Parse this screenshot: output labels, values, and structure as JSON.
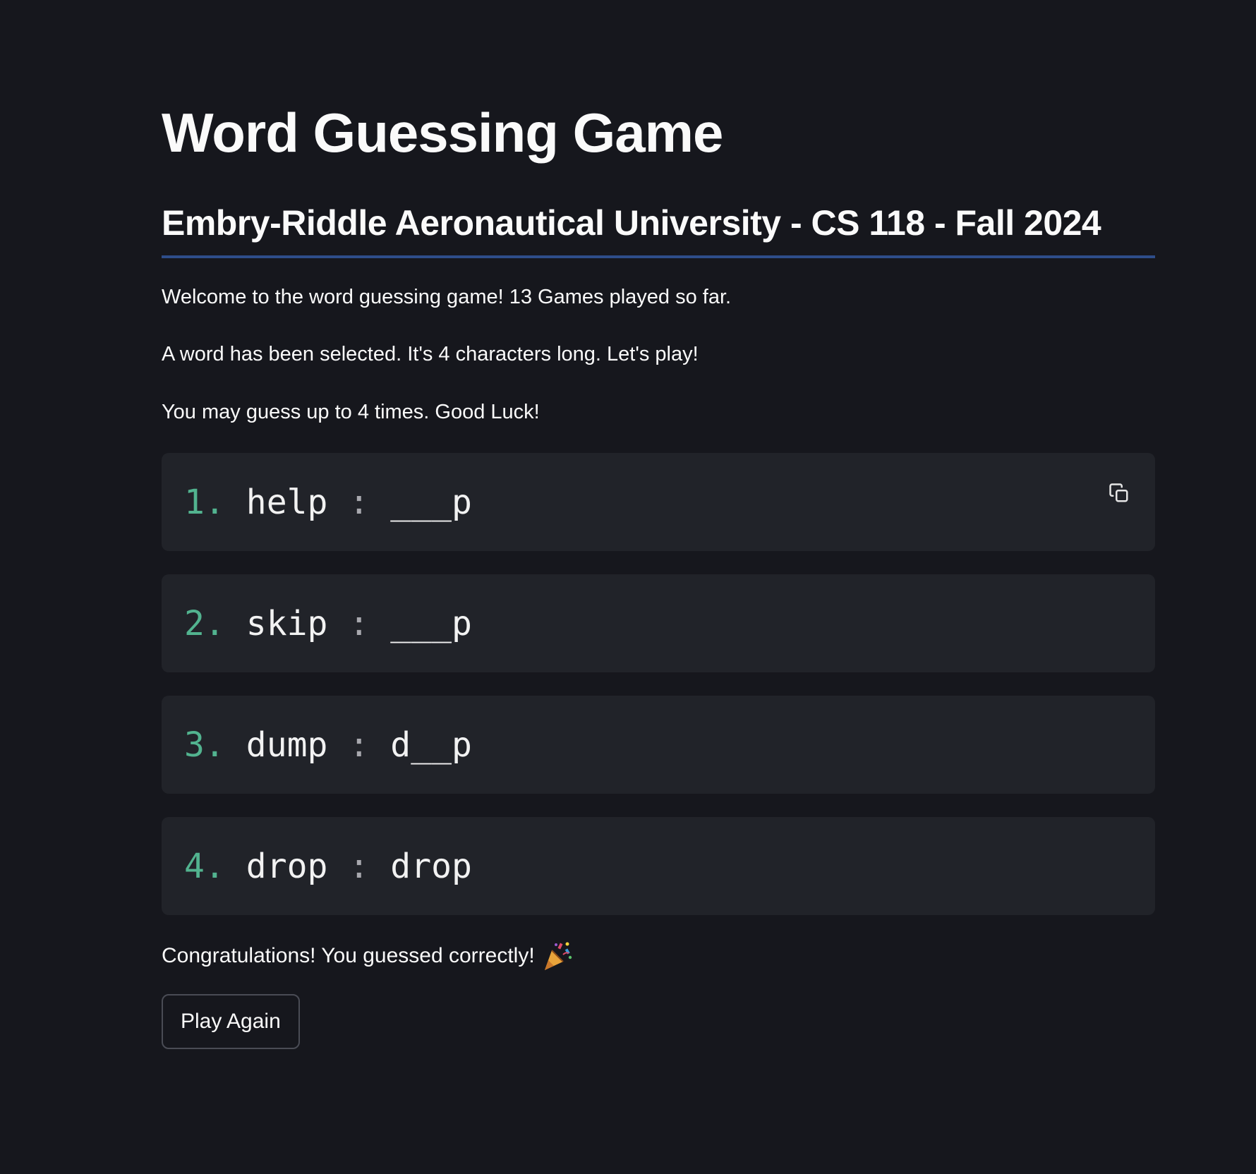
{
  "page": {
    "title": "Word Guessing Game",
    "subtitle": "Embry-Riddle Aeronautical University - CS 118 - Fall 2024"
  },
  "messages": {
    "welcome": "Welcome to the word guessing game! 13 Games played so far.",
    "selected": "A word has been selected. It's 4 characters long. Let's play!",
    "guesses": "You may guess up to 4 times. Good Luck!",
    "congrats": "Congratulations! You guessed correctly!"
  },
  "guesses": [
    {
      "num": "1.",
      "word": "help",
      "sep": ":",
      "pattern": "___p"
    },
    {
      "num": "2.",
      "word": "skip",
      "sep": ":",
      "pattern": "___p"
    },
    {
      "num": "3.",
      "word": "dump",
      "sep": ":",
      "pattern": "d__p"
    },
    {
      "num": "4.",
      "word": "drop",
      "sep": ":",
      "pattern": "drop"
    }
  ],
  "actions": {
    "play_again": "Play Again"
  },
  "icons": {
    "copy": "copy-icon",
    "celebration": "party-popper-icon"
  },
  "colors": {
    "background": "#16171d",
    "code_background": "#212329",
    "number_accent": "#52b38f",
    "subtitle_rule": "#2e4d8a"
  }
}
